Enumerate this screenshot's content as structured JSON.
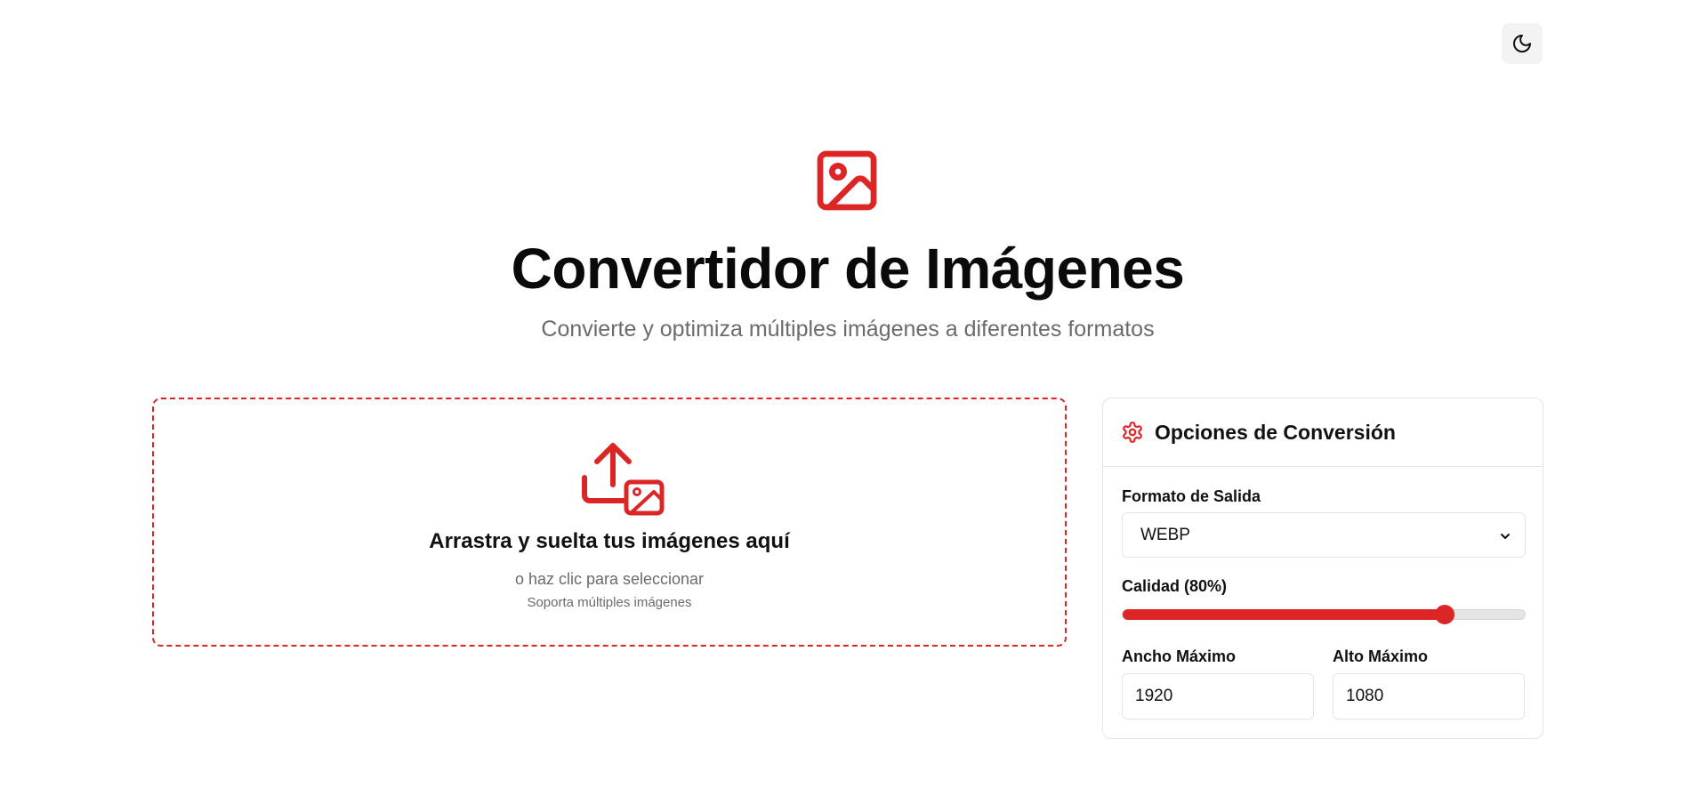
{
  "header": {
    "theme_toggle_icon": "moon-icon",
    "title": "Convertidor de Imágenes",
    "subtitle": "Convierte y optimiza múltiples imágenes a diferentes formatos",
    "hero_icon": "image-icon"
  },
  "dropzone": {
    "icon": "upload-image-icon",
    "title": "Arrastra y suelta tus imágenes aquí",
    "hint": "o haz clic para seleccionar",
    "sub": "Soporta múltiples imágenes"
  },
  "options": {
    "title": "Opciones de Conversión",
    "icon": "gear-icon",
    "format_label": "Formato de Salida",
    "format_value": "WEBP",
    "quality_label": "Calidad (80%)",
    "quality_value": 80,
    "width_label": "Ancho Máximo",
    "width_value": "1920",
    "height_label": "Alto Máximo",
    "height_value": "1080"
  },
  "colors": {
    "accent": "#dc2626",
    "text": "#111111",
    "muted": "#6b6b6b",
    "border": "#e4e4e7"
  }
}
